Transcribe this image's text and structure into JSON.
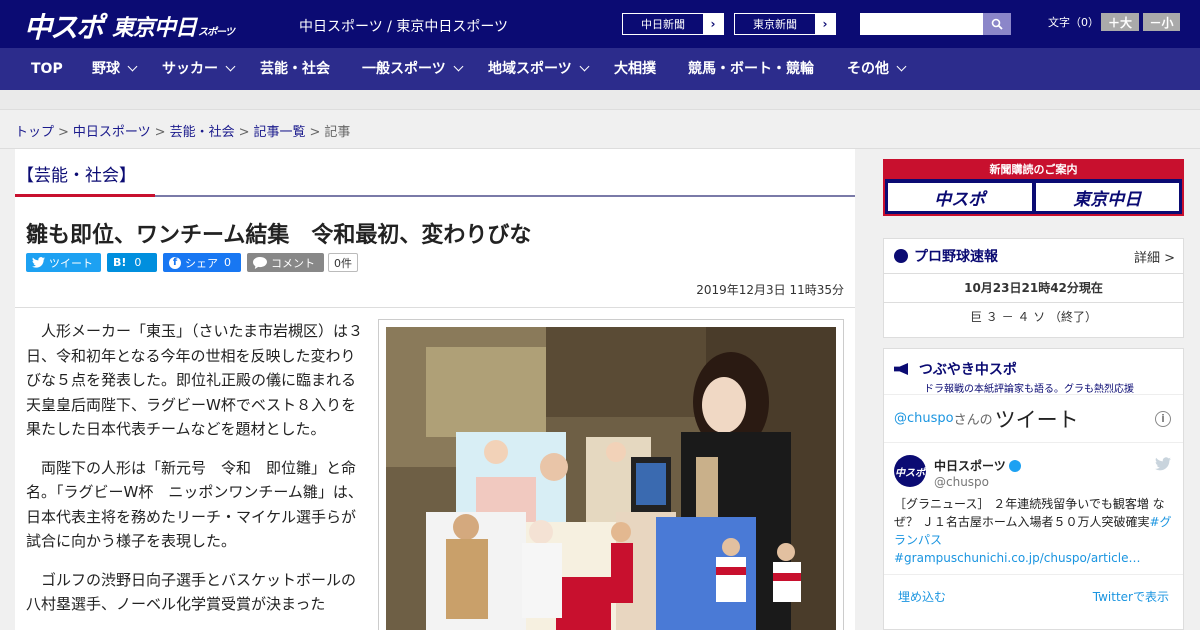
{
  "header": {
    "logo_chuspo": "中スポ",
    "logo_tokyo": "東京中日",
    "logo_tokyo_sub": "スポーツ",
    "site_names": "中日スポーツ / 東京中日スポーツ",
    "ext_buttons": [
      "中日新聞",
      "東京新聞"
    ],
    "ext_arrow": "›",
    "search_placeholder": "",
    "font_size_label": "文字（0）",
    "font_bigger": "＋大",
    "font_smaller": "－小"
  },
  "nav": {
    "items": [
      {
        "label": "TOP",
        "has_menu": false
      },
      {
        "label": "野球",
        "has_menu": true
      },
      {
        "label": "サッカー",
        "has_menu": true
      },
      {
        "label": "芸能・社会",
        "has_menu": false
      },
      {
        "label": "一般スポーツ",
        "has_menu": true
      },
      {
        "label": "地域スポーツ",
        "has_menu": true
      },
      {
        "label": "大相撲",
        "has_menu": false
      },
      {
        "label": "競馬・ボート・競輪",
        "has_menu": false
      },
      {
        "label": "その他",
        "has_menu": true
      }
    ]
  },
  "breadcrumb": {
    "items": [
      "トップ",
      "中日スポーツ",
      "芸能・社会",
      "記事一覧"
    ],
    "current": "記事",
    "separator": ">"
  },
  "article": {
    "section": "【芸能・社会】",
    "title": "雛も即位、ワンチーム結集　令和最初、変わりびな",
    "share": {
      "tweet": "ツイート",
      "hatena": "B!",
      "hatena_count": "0",
      "facebook": "シェア",
      "facebook_count": "0",
      "comment": "コメント",
      "comment_count": "0件"
    },
    "date": "2019年12月3日 11時35分",
    "paragraphs": [
      "人形メーカー「東玉」（さいたま市岩槻区）は３日、令和初年となる今年の世相を反映した変わりびな５点を発表した。即位礼正殿の儀に臨まれる天皇皇后両陛下、ラグビーW杯でベスト８入りを果たした日本代表チームなどを題材とした。",
      "両陛下の人形は「新元号　令和　即位雛」と命名。「ラグビーW杯　ニッポンワンチーム雛」は、日本代表主将を務めたリーチ・マイケル選手らが試合に向かう様子を表現した。",
      "ゴルフの渋野日向子選手とバスケットボールの八村塁選手、ノーベル化学賞受賞が決まった"
    ]
  },
  "sidebar": {
    "ad": {
      "top": "新聞購読のご案内",
      "logo1": "中スポ",
      "logo2": "東京中日"
    },
    "baseball": {
      "title": "プロ野球速報",
      "more": "詳細 >",
      "time": "10月23日21時42分現在",
      "score": "巨 ３ － ４ ソ （終了）"
    },
    "tweets": {
      "title": "つぶやき中スポ",
      "subtitle": "ドラ報戦の本紙評論家も語る。グラも熱烈応援",
      "handle": "@chuspo",
      "handle_suffix": "さんの",
      "header_big": "ツイート",
      "author": "中日スポーツ",
      "author_sn": "@chuspo",
      "avatar_text": "中スポ",
      "text": "［グラニュース］ ２年連続残留争いでも観客増 なぜ？ Ｊ１名古屋ホーム入場者５０万人突破確実",
      "text_link": "#グランパス #grampuschunichi.co.jp/chuspo/article…",
      "embed": "埋め込む",
      "view_on": "Twitterで表示"
    }
  },
  "colors": {
    "header_bg": "#0b0b73",
    "nav_bg": "#2c2c8c",
    "accent_red": "#c8102e",
    "link_blue": "#1b95e0"
  }
}
